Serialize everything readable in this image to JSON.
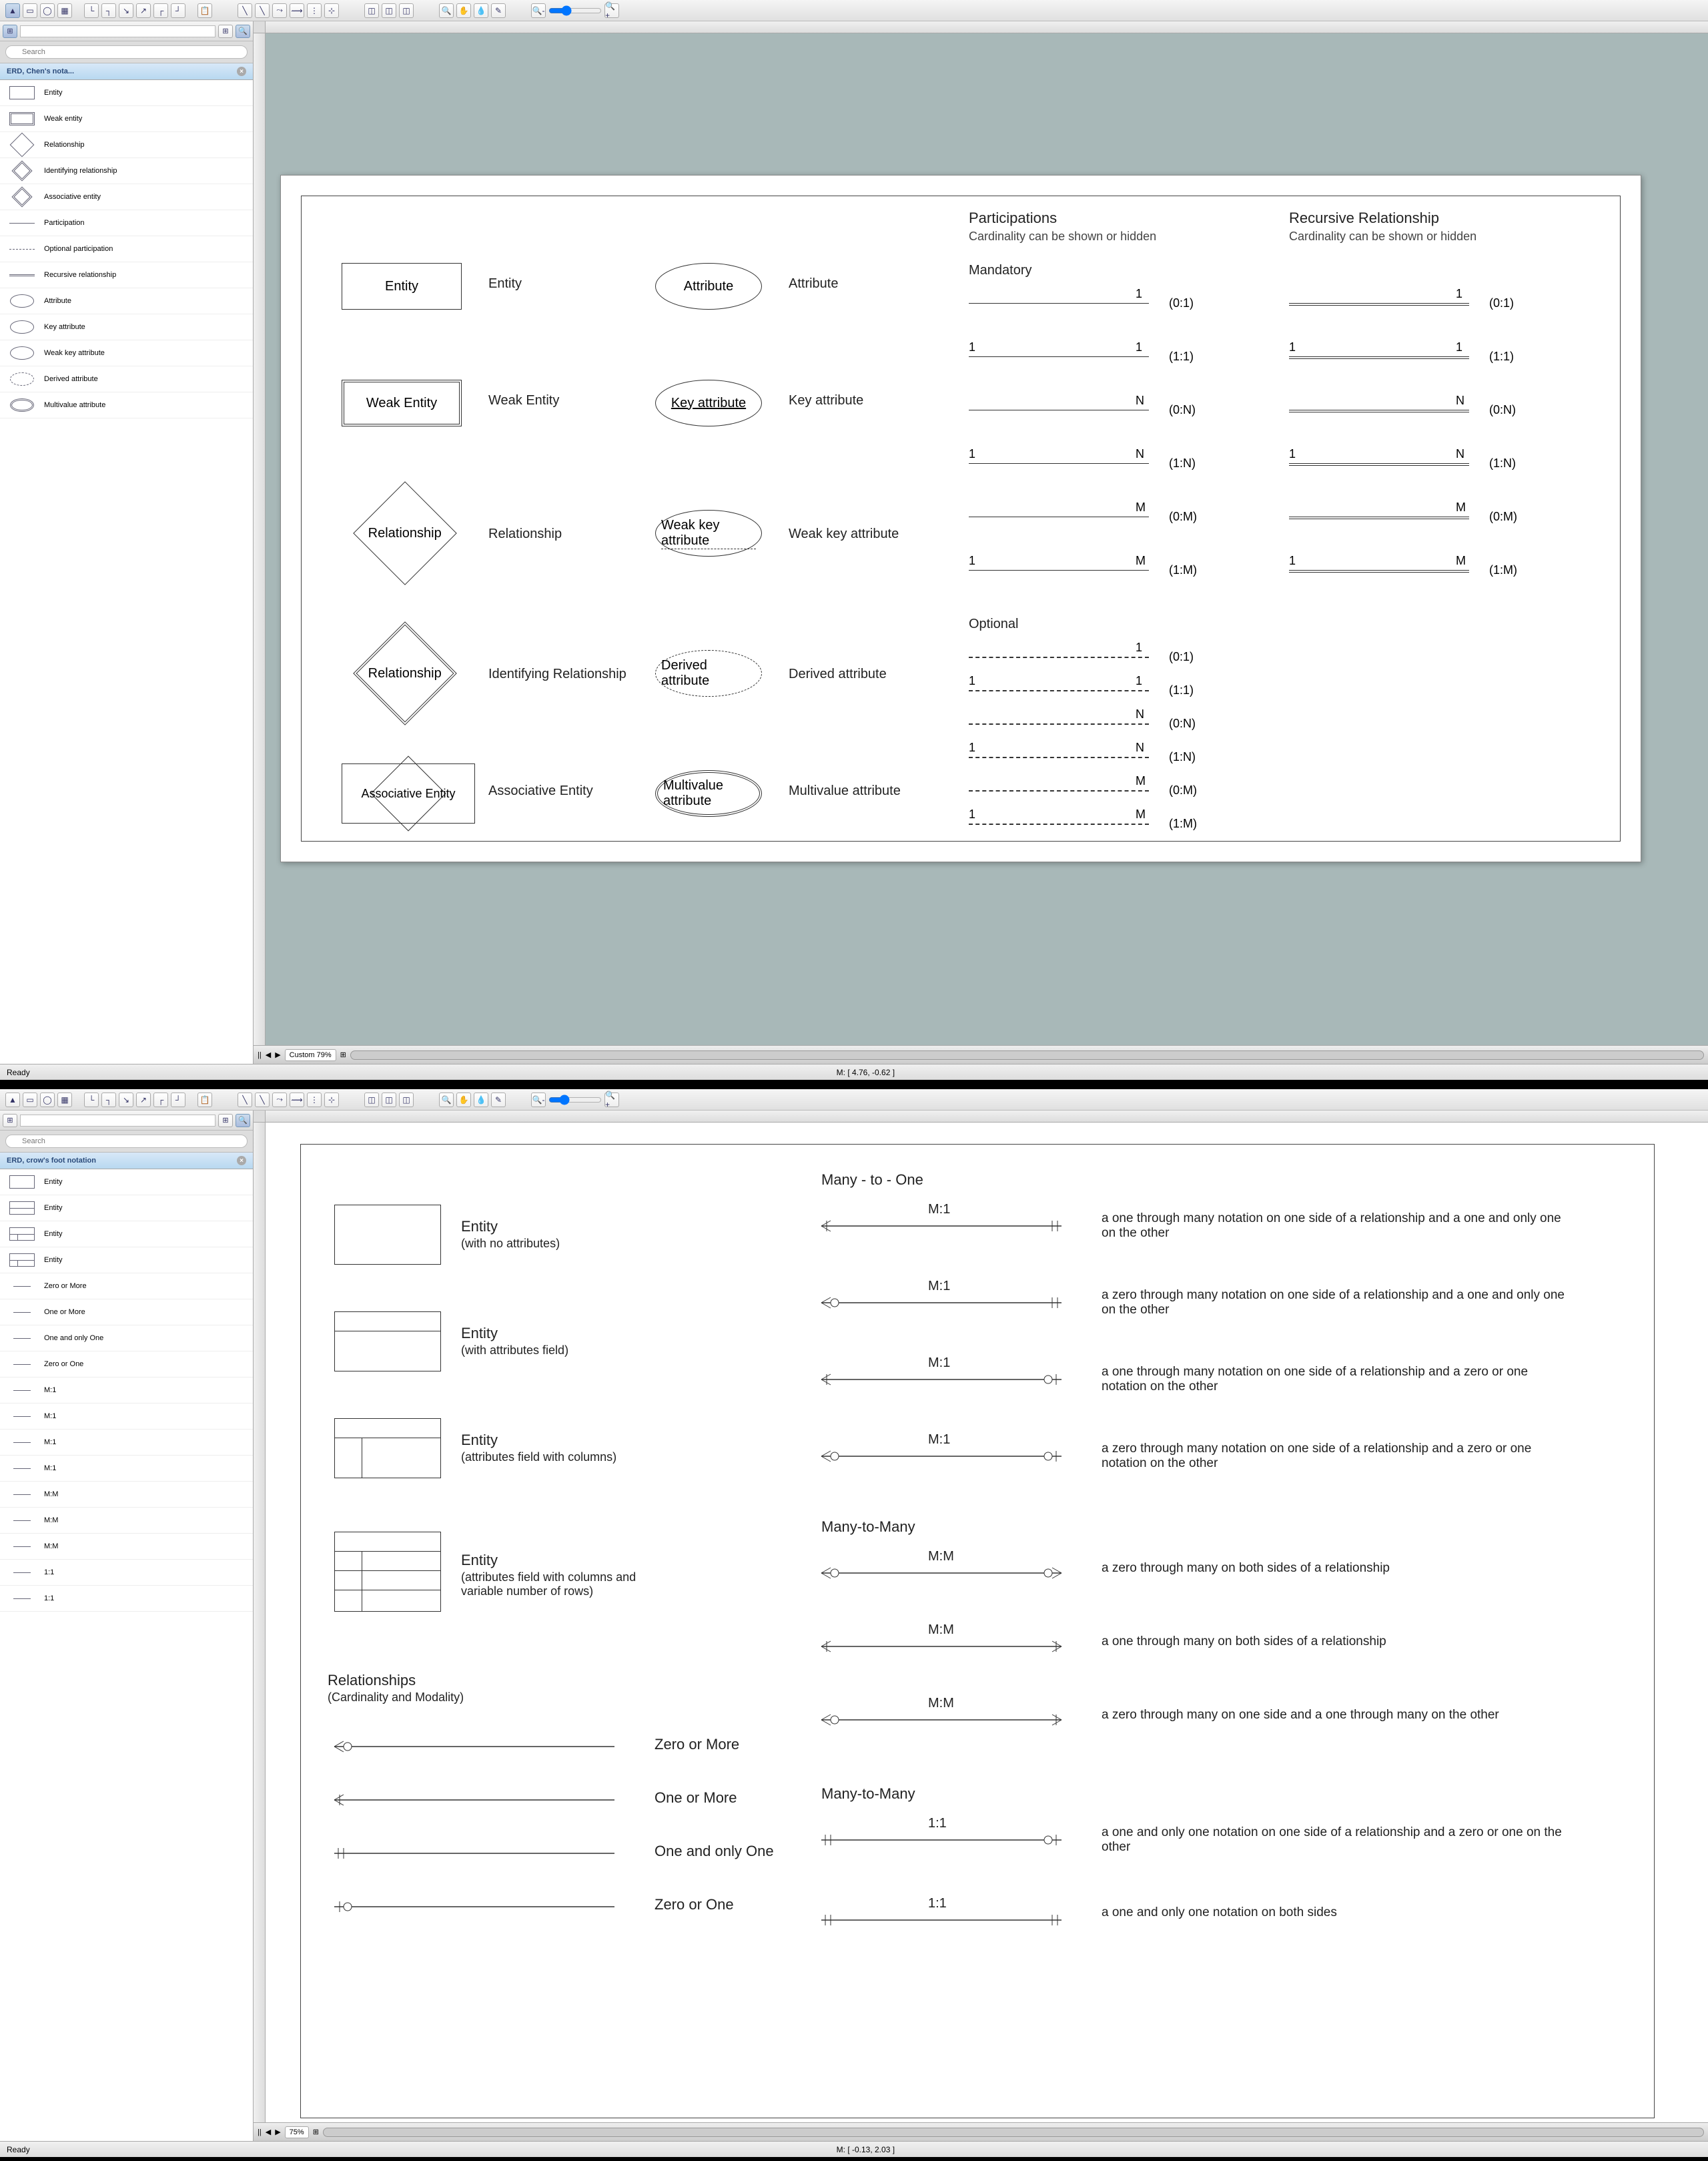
{
  "win1": {
    "search_placeholder": "Search",
    "palette_title": "ERD, Chen's nota...",
    "palette_items": [
      {
        "label": "Entity",
        "icon": "rect"
      },
      {
        "label": "Weak entity",
        "icon": "rect-dbl"
      },
      {
        "label": "Relationship",
        "icon": "diamond"
      },
      {
        "label": "Identifying relationship",
        "icon": "diamond-dbl"
      },
      {
        "label": "Associative entity",
        "icon": "diamond-dbl"
      },
      {
        "label": "Participation",
        "icon": "line"
      },
      {
        "label": "Optional participation",
        "icon": "line-dash"
      },
      {
        "label": "Recursive relationship",
        "icon": "line-dbl"
      },
      {
        "label": "Attribute",
        "icon": "oval"
      },
      {
        "label": "Key attribute",
        "icon": "oval"
      },
      {
        "label": "Weak key attribute",
        "icon": "oval"
      },
      {
        "label": "Derived attribute",
        "icon": "oval-dash"
      },
      {
        "label": "Multivalue attribute",
        "icon": "oval-dbl"
      }
    ],
    "doc": {
      "col1": [
        {
          "shape": "Entity",
          "label": "Entity"
        },
        {
          "shape": "Weak Entity",
          "label": "Weak Entity"
        },
        {
          "shape": "Relationship",
          "label": "Relationship"
        },
        {
          "shape": "Relationship",
          "label": "Identifying Relationship"
        },
        {
          "shape": "Associative Entity",
          "label": "Associative Entity"
        }
      ],
      "col2": [
        {
          "shape": "Attribute",
          "label": "Attribute"
        },
        {
          "shape": "Key attribute",
          "label": "Key attribute"
        },
        {
          "shape": "Weak key attribute",
          "label": "Weak key attribute"
        },
        {
          "shape": "Derived attribute",
          "label": "Derived attribute"
        },
        {
          "shape": "Multivalue attribute",
          "label": "Multivalue attribute"
        }
      ],
      "participations_title": "Participations",
      "participations_sub": "Cardinality can be shown or hidden",
      "mandatory_title": "Mandatory",
      "optional_title": "Optional",
      "recursive_title": "Recursive Relationship",
      "recursive_sub": "Cardinality can be shown or hidden",
      "mandatory": [
        {
          "l": "",
          "r": "1",
          "c": "(0:1)"
        },
        {
          "l": "1",
          "r": "1",
          "c": "(1:1)"
        },
        {
          "l": "",
          "r": "N",
          "c": "(0:N)"
        },
        {
          "l": "1",
          "r": "N",
          "c": "(1:N)"
        },
        {
          "l": "",
          "r": "M",
          "c": "(0:M)"
        },
        {
          "l": "1",
          "r": "M",
          "c": "(1:M)"
        }
      ],
      "optional": [
        {
          "l": "",
          "r": "1",
          "c": "(0:1)"
        },
        {
          "l": "1",
          "r": "1",
          "c": "(1:1)"
        },
        {
          "l": "",
          "r": "N",
          "c": "(0:N)"
        },
        {
          "l": "1",
          "r": "N",
          "c": "(1:N)"
        },
        {
          "l": "",
          "r": "M",
          "c": "(0:M)"
        },
        {
          "l": "1",
          "r": "M",
          "c": "(1:M)"
        }
      ],
      "recursive": [
        {
          "l": "",
          "r": "1",
          "c": "(0:1)"
        },
        {
          "l": "1",
          "r": "1",
          "c": "(1:1)"
        },
        {
          "l": "",
          "r": "N",
          "c": "(0:N)"
        },
        {
          "l": "1",
          "r": "N",
          "c": "(1:N)"
        },
        {
          "l": "",
          "r": "M",
          "c": "(0:M)"
        },
        {
          "l": "1",
          "r": "M",
          "c": "(1:M)"
        }
      ]
    },
    "zoom": "Custom 79%",
    "status_left": "Ready",
    "status_center": "M: [ 4.76, -0.62 ]"
  },
  "win2": {
    "search_placeholder": "Search",
    "palette_title": "ERD, crow's foot notation",
    "palette_items": [
      {
        "label": "Entity",
        "icon": "rect"
      },
      {
        "label": "Entity",
        "icon": "rect-grid"
      },
      {
        "label": "Entity",
        "icon": "rect-grid2"
      },
      {
        "label": "Entity",
        "icon": "rect-grid2"
      },
      {
        "label": "Zero or More",
        "icon": "rel"
      },
      {
        "label": "One or More",
        "icon": "rel"
      },
      {
        "label": "One and only One",
        "icon": "rel"
      },
      {
        "label": "Zero or One",
        "icon": "rel"
      },
      {
        "label": "M:1",
        "icon": "rel"
      },
      {
        "label": "M:1",
        "icon": "rel"
      },
      {
        "label": "M:1",
        "icon": "rel"
      },
      {
        "label": "M:1",
        "icon": "rel"
      },
      {
        "label": "M:M",
        "icon": "rel"
      },
      {
        "label": "M:M",
        "icon": "rel"
      },
      {
        "label": "M:M",
        "icon": "rel"
      },
      {
        "label": "1:1",
        "icon": "rel"
      },
      {
        "label": "1:1",
        "icon": "rel"
      }
    ],
    "doc": {
      "entities": [
        {
          "title": "Entity",
          "sub": "(with no attributes)"
        },
        {
          "title": "Entity",
          "sub": "(with attributes field)"
        },
        {
          "title": "Entity",
          "sub": "(attributes field with columns)"
        },
        {
          "title": "Entity",
          "sub": "(attributes field with columns and variable number of rows)"
        }
      ],
      "relationships_title": "Relationships",
      "relationships_sub": "(Cardinality and Modality)",
      "basic_rels": [
        "Zero or More",
        "One or More",
        "One and only One",
        "Zero or One"
      ],
      "m1_title": "Many - to - One",
      "m1": [
        {
          "sym": "M:1",
          "desc": "a one through many notation on one side of a relationship and a one and only one on the other"
        },
        {
          "sym": "M:1",
          "desc": "a zero through many notation on one side of a relationship and a one and only one on the other"
        },
        {
          "sym": "M:1",
          "desc": "a one through many notation on one side of a relationship and a zero or one notation on the other"
        },
        {
          "sym": "M:1",
          "desc": "a zero through many notation on one side of a relationship and a zero or one notation on the other"
        }
      ],
      "mm_title": "Many-to-Many",
      "mm": [
        {
          "sym": "M:M",
          "desc": "a zero through many on both sides of a relationship"
        },
        {
          "sym": "M:M",
          "desc": "a one through many on both sides of a relationship"
        },
        {
          "sym": "M:M",
          "desc": "a zero through many on one side and a one through many on the other"
        }
      ],
      "oo_title": "Many-to-Many",
      "oo": [
        {
          "sym": "1:1",
          "desc": "a one and only one notation on one side of a relationship and a zero or one on the other"
        },
        {
          "sym": "1:1",
          "desc": "a one and only one notation on both sides"
        }
      ]
    },
    "zoom": "75%",
    "status_left": "Ready",
    "status_center": "M: [ -0.13, 2.03 ]"
  }
}
